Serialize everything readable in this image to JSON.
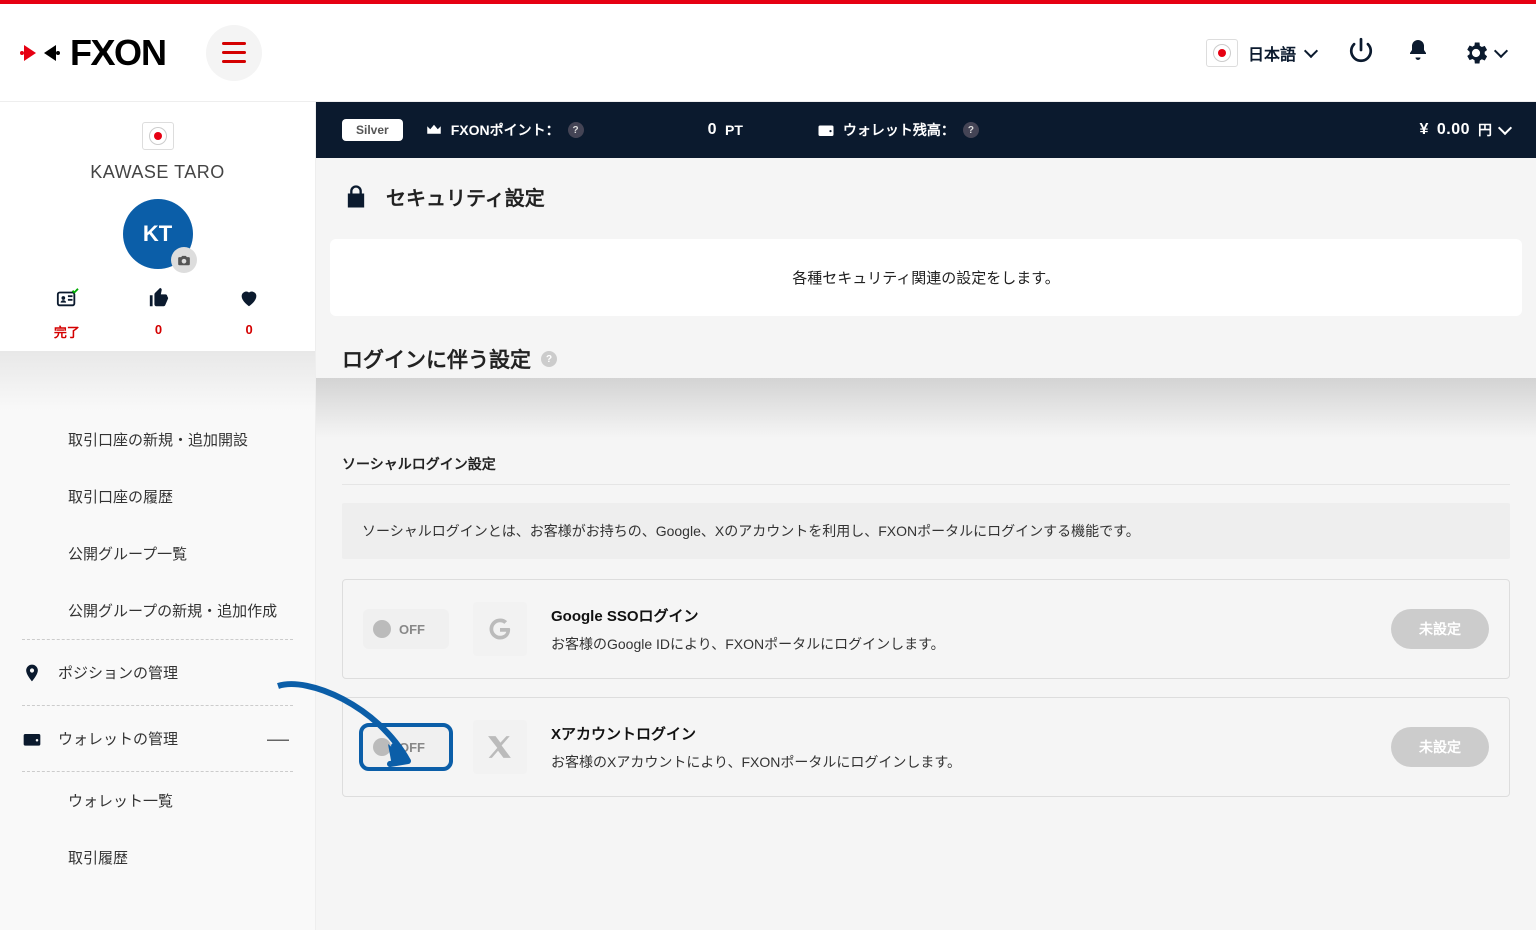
{
  "header": {
    "brand": "FXON",
    "language_label": "日本語"
  },
  "sidebar": {
    "profile": {
      "name": "KAWASE TARO",
      "initials": "KT"
    },
    "stats": {
      "completed": {
        "label": "完了"
      },
      "likes": {
        "value": "0"
      },
      "favorites": {
        "value": "0"
      }
    },
    "items": [
      {
        "label": "取引口座の新規・追加開設"
      },
      {
        "label": "取引口座の履歴"
      },
      {
        "label": "公開グループ一覧"
      },
      {
        "label": "公開グループの新規・追加作成"
      }
    ],
    "position_mgmt": "ポジションの管理",
    "wallet_mgmt": "ウォレットの管理",
    "wallet_items": [
      {
        "label": "ウォレット一覧"
      },
      {
        "label": "取引履歴"
      }
    ]
  },
  "pointsbar": {
    "tier": "Silver",
    "points_label": "FXONポイント：",
    "points_value": "0",
    "points_unit": "PT",
    "wallet_label": "ウォレット残高：",
    "wallet_currency_symbol": "¥",
    "wallet_value": "0.00",
    "wallet_currency": "円"
  },
  "page": {
    "title": "セキュリティ設定",
    "lead": "各種セキュリティ関連の設定をします。",
    "login_section_title": "ログインに伴う設定",
    "social_subtitle": "ソーシャルログイン設定",
    "social_info": "ソーシャルログインとは、お客様がお持ちの、Google、Xのアカウントを利用し、FXONポータルにログインする機能です。",
    "toggle_off": "OFF",
    "unset_label": "未設定",
    "providers": {
      "google": {
        "title": "Google SSOログイン",
        "desc": "お客様のGoogle IDにより、FXONポータルにログインします。"
      },
      "x": {
        "title": "Xアカウントログイン",
        "desc": "お客様のXアカウントにより、FXONポータルにログインします。"
      }
    }
  }
}
